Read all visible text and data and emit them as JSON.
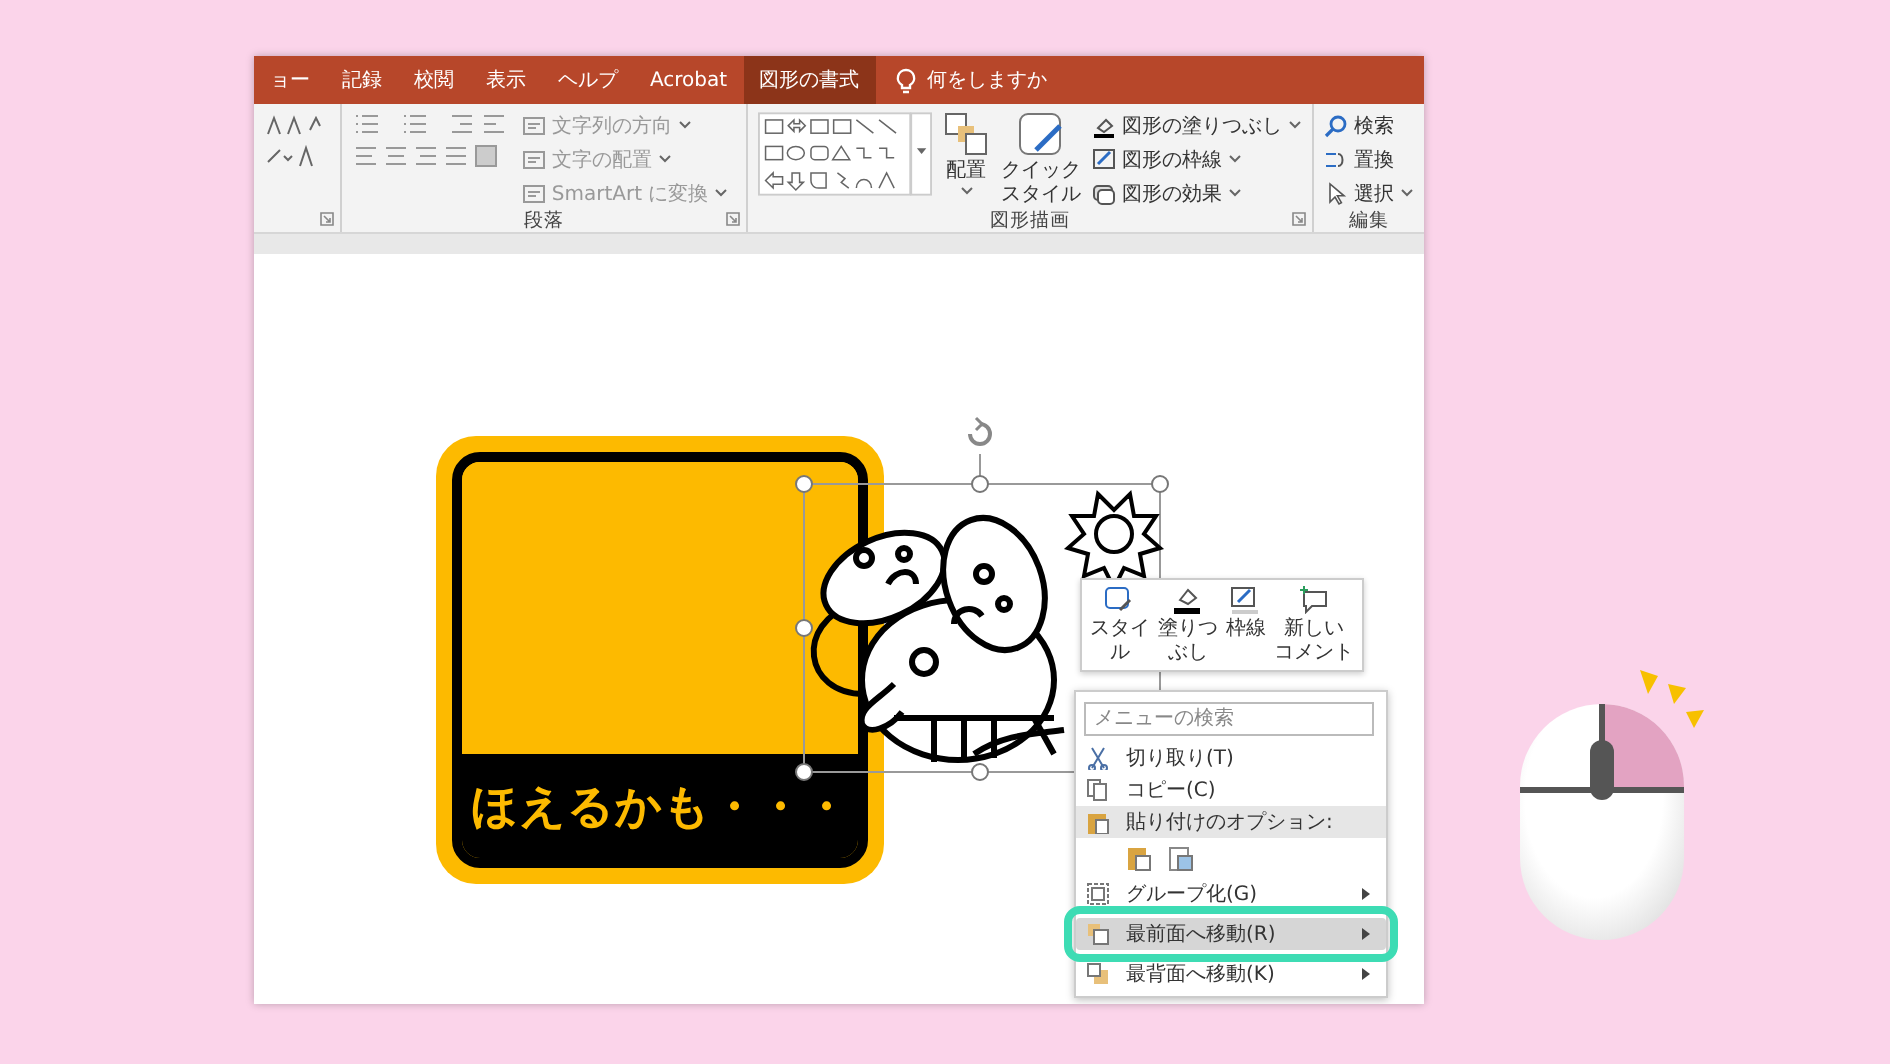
{
  "ribbon": {
    "tabs": [
      {
        "label": "ョー",
        "selected": false
      },
      {
        "label": "記録",
        "selected": false
      },
      {
        "label": "校閲",
        "selected": false
      },
      {
        "label": "表示",
        "selected": false
      },
      {
        "label": "ヘルプ",
        "selected": false
      },
      {
        "label": "Acrobat",
        "selected": false
      },
      {
        "label": "図形の書式",
        "selected": true
      }
    ],
    "tell_me": "何をしますか",
    "paragraph": {
      "label": "段落",
      "commands": [
        "文字列の方向",
        "文字の配置",
        "SmartArt に変換"
      ]
    },
    "drawing": {
      "label": "図形描画",
      "arrange": "配置",
      "quick_style": "クイックスタイル",
      "commands": [
        "図形の塗りつぶし",
        "図形の枠線",
        "図形の効果"
      ]
    },
    "editing": {
      "label": "編集",
      "commands": [
        "検索",
        "置換",
        "選択"
      ]
    }
  },
  "slide": {
    "sign_text": "ほえるかも・・・"
  },
  "mini_toolbar": [
    {
      "lines": [
        "スタイ",
        "ル"
      ]
    },
    {
      "lines": [
        "塗りつ",
        "ぶし"
      ]
    },
    {
      "lines": [
        "枠線"
      ]
    },
    {
      "lines": [
        "新しい",
        "コメント"
      ]
    }
  ],
  "context_menu": {
    "search_placeholder": "メニューの検索",
    "items": [
      {
        "kind": "command",
        "label": "切り取り(T)",
        "submenu": false,
        "selected": false
      },
      {
        "kind": "command",
        "label": "コピー(C)",
        "submenu": false,
        "selected": false
      },
      {
        "kind": "header",
        "label": "貼り付けのオプション:"
      },
      {
        "kind": "paste_icons"
      },
      {
        "kind": "command",
        "label": "グループ化(G)",
        "submenu": true,
        "selected": false
      },
      {
        "kind": "command",
        "label": "最前面へ移動(R)",
        "submenu": true,
        "selected": true
      },
      {
        "kind": "command",
        "label": "最背面へ移動(K)",
        "submenu": true,
        "selected": false
      }
    ]
  }
}
